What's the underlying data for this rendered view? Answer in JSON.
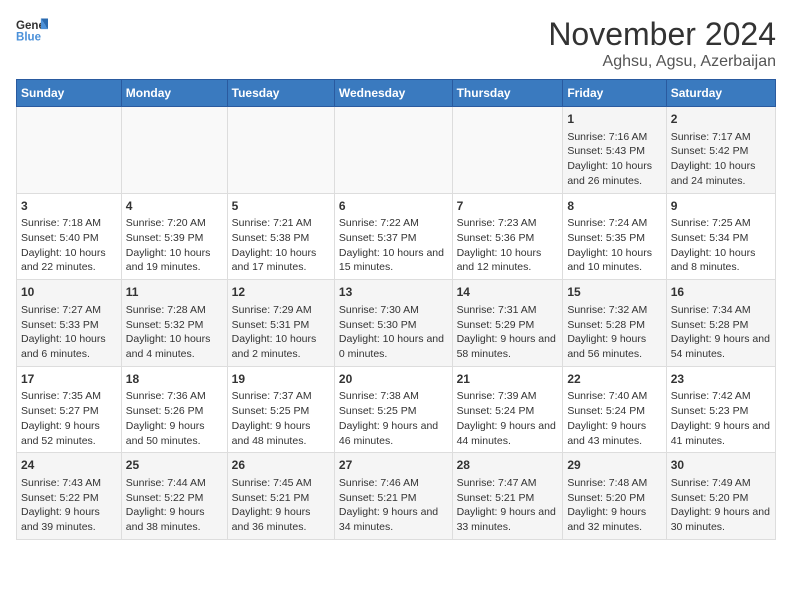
{
  "logo": {
    "line1": "General",
    "line2": "Blue"
  },
  "title": "November 2024",
  "subtitle": "Aghsu, Agsu, Azerbaijan",
  "weekdays": [
    "Sunday",
    "Monday",
    "Tuesday",
    "Wednesday",
    "Thursday",
    "Friday",
    "Saturday"
  ],
  "weeks": [
    [
      {
        "day": "",
        "content": ""
      },
      {
        "day": "",
        "content": ""
      },
      {
        "day": "",
        "content": ""
      },
      {
        "day": "",
        "content": ""
      },
      {
        "day": "",
        "content": ""
      },
      {
        "day": "1",
        "content": "Sunrise: 7:16 AM\nSunset: 5:43 PM\nDaylight: 10 hours and 26 minutes."
      },
      {
        "day": "2",
        "content": "Sunrise: 7:17 AM\nSunset: 5:42 PM\nDaylight: 10 hours and 24 minutes."
      }
    ],
    [
      {
        "day": "3",
        "content": "Sunrise: 7:18 AM\nSunset: 5:40 PM\nDaylight: 10 hours and 22 minutes."
      },
      {
        "day": "4",
        "content": "Sunrise: 7:20 AM\nSunset: 5:39 PM\nDaylight: 10 hours and 19 minutes."
      },
      {
        "day": "5",
        "content": "Sunrise: 7:21 AM\nSunset: 5:38 PM\nDaylight: 10 hours and 17 minutes."
      },
      {
        "day": "6",
        "content": "Sunrise: 7:22 AM\nSunset: 5:37 PM\nDaylight: 10 hours and 15 minutes."
      },
      {
        "day": "7",
        "content": "Sunrise: 7:23 AM\nSunset: 5:36 PM\nDaylight: 10 hours and 12 minutes."
      },
      {
        "day": "8",
        "content": "Sunrise: 7:24 AM\nSunset: 5:35 PM\nDaylight: 10 hours and 10 minutes."
      },
      {
        "day": "9",
        "content": "Sunrise: 7:25 AM\nSunset: 5:34 PM\nDaylight: 10 hours and 8 minutes."
      }
    ],
    [
      {
        "day": "10",
        "content": "Sunrise: 7:27 AM\nSunset: 5:33 PM\nDaylight: 10 hours and 6 minutes."
      },
      {
        "day": "11",
        "content": "Sunrise: 7:28 AM\nSunset: 5:32 PM\nDaylight: 10 hours and 4 minutes."
      },
      {
        "day": "12",
        "content": "Sunrise: 7:29 AM\nSunset: 5:31 PM\nDaylight: 10 hours and 2 minutes."
      },
      {
        "day": "13",
        "content": "Sunrise: 7:30 AM\nSunset: 5:30 PM\nDaylight: 10 hours and 0 minutes."
      },
      {
        "day": "14",
        "content": "Sunrise: 7:31 AM\nSunset: 5:29 PM\nDaylight: 9 hours and 58 minutes."
      },
      {
        "day": "15",
        "content": "Sunrise: 7:32 AM\nSunset: 5:28 PM\nDaylight: 9 hours and 56 minutes."
      },
      {
        "day": "16",
        "content": "Sunrise: 7:34 AM\nSunset: 5:28 PM\nDaylight: 9 hours and 54 minutes."
      }
    ],
    [
      {
        "day": "17",
        "content": "Sunrise: 7:35 AM\nSunset: 5:27 PM\nDaylight: 9 hours and 52 minutes."
      },
      {
        "day": "18",
        "content": "Sunrise: 7:36 AM\nSunset: 5:26 PM\nDaylight: 9 hours and 50 minutes."
      },
      {
        "day": "19",
        "content": "Sunrise: 7:37 AM\nSunset: 5:25 PM\nDaylight: 9 hours and 48 minutes."
      },
      {
        "day": "20",
        "content": "Sunrise: 7:38 AM\nSunset: 5:25 PM\nDaylight: 9 hours and 46 minutes."
      },
      {
        "day": "21",
        "content": "Sunrise: 7:39 AM\nSunset: 5:24 PM\nDaylight: 9 hours and 44 minutes."
      },
      {
        "day": "22",
        "content": "Sunrise: 7:40 AM\nSunset: 5:24 PM\nDaylight: 9 hours and 43 minutes."
      },
      {
        "day": "23",
        "content": "Sunrise: 7:42 AM\nSunset: 5:23 PM\nDaylight: 9 hours and 41 minutes."
      }
    ],
    [
      {
        "day": "24",
        "content": "Sunrise: 7:43 AM\nSunset: 5:22 PM\nDaylight: 9 hours and 39 minutes."
      },
      {
        "day": "25",
        "content": "Sunrise: 7:44 AM\nSunset: 5:22 PM\nDaylight: 9 hours and 38 minutes."
      },
      {
        "day": "26",
        "content": "Sunrise: 7:45 AM\nSunset: 5:21 PM\nDaylight: 9 hours and 36 minutes."
      },
      {
        "day": "27",
        "content": "Sunrise: 7:46 AM\nSunset: 5:21 PM\nDaylight: 9 hours and 34 minutes."
      },
      {
        "day": "28",
        "content": "Sunrise: 7:47 AM\nSunset: 5:21 PM\nDaylight: 9 hours and 33 minutes."
      },
      {
        "day": "29",
        "content": "Sunrise: 7:48 AM\nSunset: 5:20 PM\nDaylight: 9 hours and 32 minutes."
      },
      {
        "day": "30",
        "content": "Sunrise: 7:49 AM\nSunset: 5:20 PM\nDaylight: 9 hours and 30 minutes."
      }
    ]
  ]
}
